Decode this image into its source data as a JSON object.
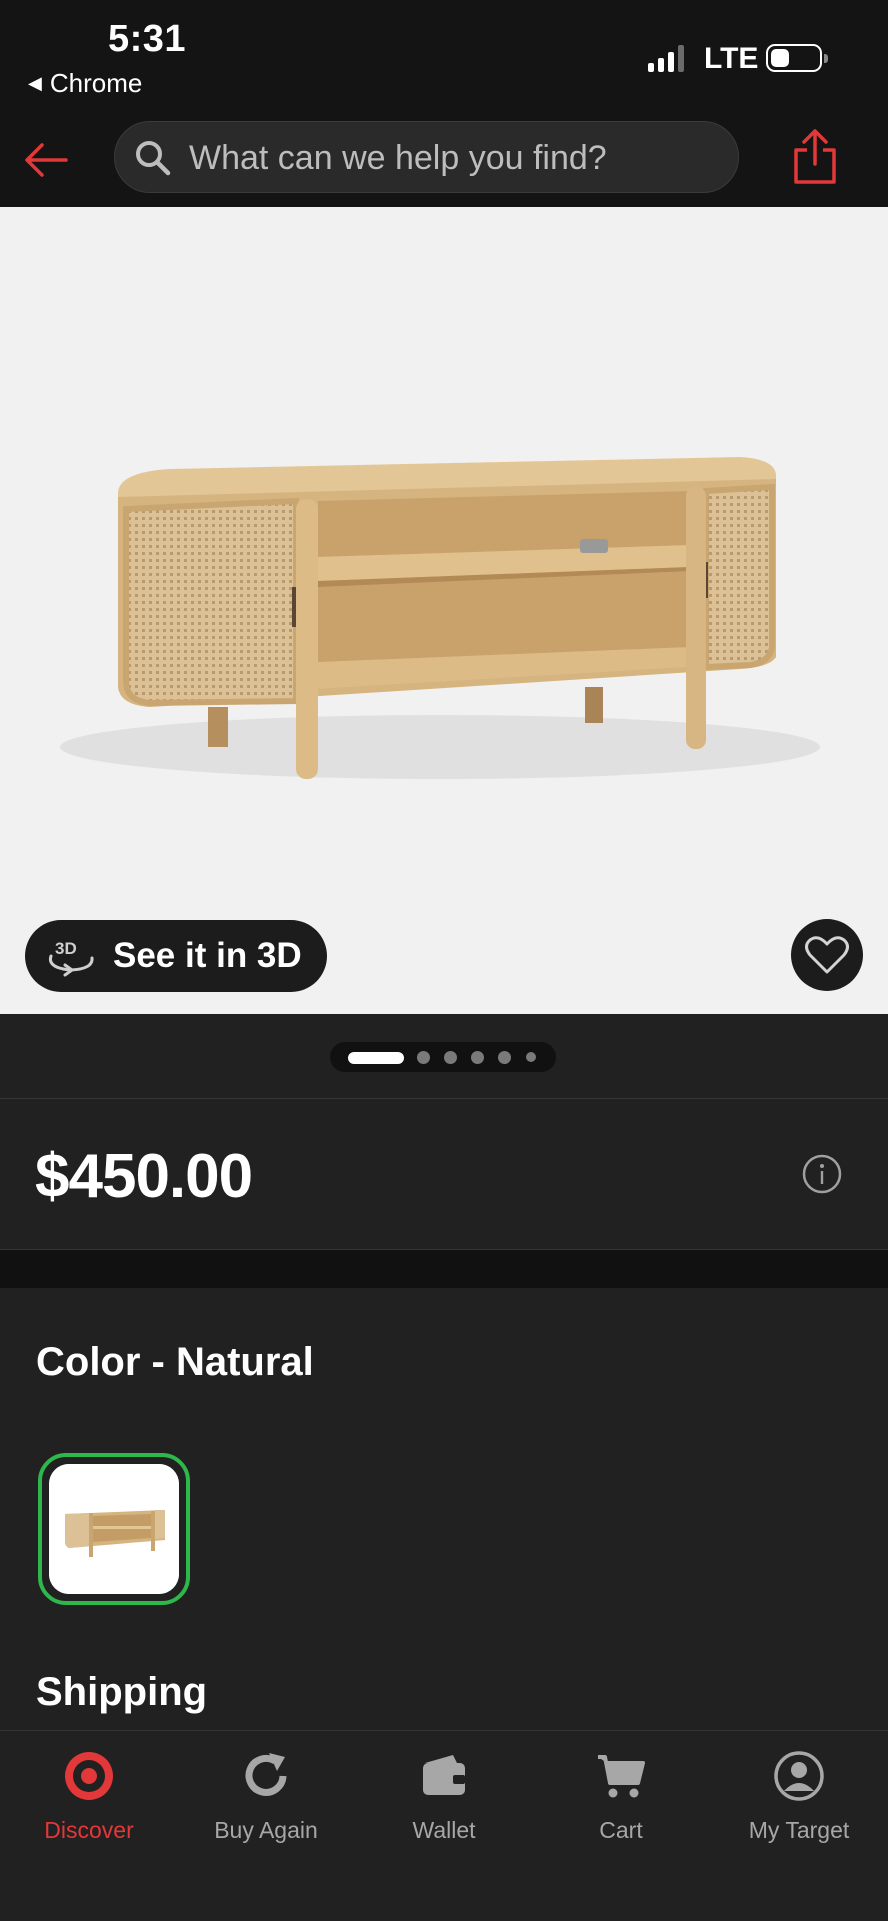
{
  "status_bar": {
    "time": "5:31",
    "back_app": "Chrome",
    "carrier": "LTE"
  },
  "search": {
    "placeholder": "What can we help you find?"
  },
  "hero": {
    "view_3d_label": "See it in 3D",
    "view_3d_icon_text": "3D",
    "pager": {
      "total": 6,
      "current": 1
    }
  },
  "product": {
    "price": "$450.00"
  },
  "color": {
    "title": "Color - Natural"
  },
  "shipping": {
    "title": "Shipping"
  },
  "tabs": [
    {
      "label": "Discover",
      "icon": "target-logo-icon",
      "active": true
    },
    {
      "label": "Buy Again",
      "icon": "refresh-icon",
      "active": false
    },
    {
      "label": "Wallet",
      "icon": "wallet-icon",
      "active": false
    },
    {
      "label": "Cart",
      "icon": "cart-icon",
      "active": false
    },
    {
      "label": "My Target",
      "icon": "account-icon",
      "active": false
    }
  ],
  "colors": {
    "accent": "#e2383a",
    "selected_swatch": "#2eb84b",
    "background": "#212121",
    "header": "#141414"
  }
}
